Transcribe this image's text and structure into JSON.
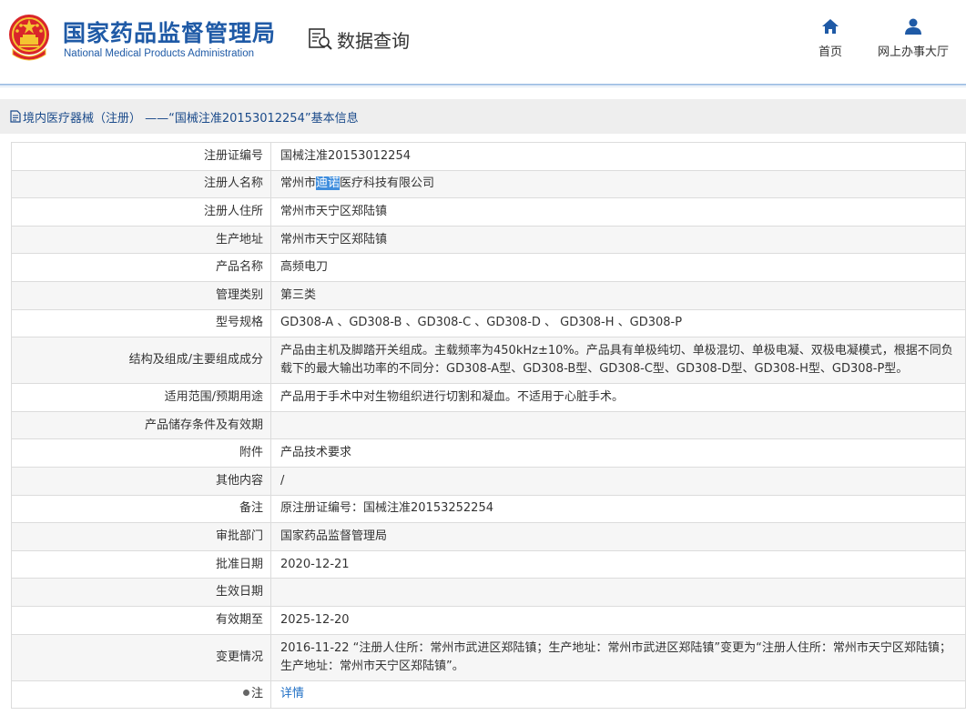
{
  "header": {
    "org_name_cn": "国家药品监督管理局",
    "org_name_en": "National Medical Products Administration",
    "query_label": "数据查询",
    "nav": [
      {
        "label": "首页",
        "icon": "home-icon"
      },
      {
        "label": "网上办事大厅",
        "icon": "user-icon"
      }
    ]
  },
  "page": {
    "title": "境内医疗器械（注册） ——“国械注准20153012254”基本信息"
  },
  "colors": {
    "brand_blue": "#1f5aa6",
    "link_blue": "#1f6fc5",
    "highlight": "#3e8ddd"
  },
  "records": {
    "reg_no": {
      "label": "注册证编号",
      "value": "国械注准20153012254"
    },
    "registrant_name": {
      "label": "注册人名称",
      "value_prefix": "常州市",
      "value_selected": "迪诺",
      "value_suffix": "医疗科技有限公司"
    },
    "registrant_address": {
      "label": "注册人住所",
      "value": "常州市天宁区郑陆镇"
    },
    "production_address": {
      "label": "生产地址",
      "value": "常州市天宁区郑陆镇"
    },
    "product_name": {
      "label": "产品名称",
      "value": "高频电刀"
    },
    "management_class": {
      "label": "管理类别",
      "value": "第三类"
    },
    "model_spec": {
      "label": "型号规格",
      "value": "GD308-A 、GD308-B 、GD308-C 、GD308-D 、 GD308-H 、GD308-P"
    },
    "structure": {
      "label": "结构及组成/主要组成成分",
      "value": "产品由主机及脚踏开关组成。主载频率为450kHz±10%。产品具有单极纯切、单极混切、单极电凝、双极电凝模式，根据不同负载下的最大输出功率的不同分：GD308-A型、GD308-B型、GD308-C型、GD308-D型、GD308-H型、GD308-P型。"
    },
    "intended_use": {
      "label": "适用范围/预期用途",
      "value": "产品用于手术中对生物组织进行切割和凝血。不适用于心脏手术。"
    },
    "storage": {
      "label": "产品储存条件及有效期",
      "value": ""
    },
    "attachment": {
      "label": "附件",
      "value": "产品技术要求"
    },
    "other": {
      "label": "其他内容",
      "value": "/"
    },
    "remark": {
      "label": "备注",
      "value": "原注册证编号：国械注准20153252254"
    },
    "approval_dept": {
      "label": "审批部门",
      "value": "国家药品监督管理局"
    },
    "approval_date": {
      "label": "批准日期",
      "value": "2020-12-21"
    },
    "effective_date": {
      "label": "生效日期",
      "value": ""
    },
    "valid_until": {
      "label": "有效期至",
      "value": "2025-12-20"
    },
    "change_history": {
      "label": "变更情况",
      "value": "2016-11-22 “注册人住所：常州市武进区郑陆镇；生产地址：常州市武进区郑陆镇”变更为“注册人住所：常州市天宁区郑陆镇；生产地址：常州市天宁区郑陆镇”。"
    },
    "note": {
      "label": "注",
      "value": "详情"
    }
  }
}
